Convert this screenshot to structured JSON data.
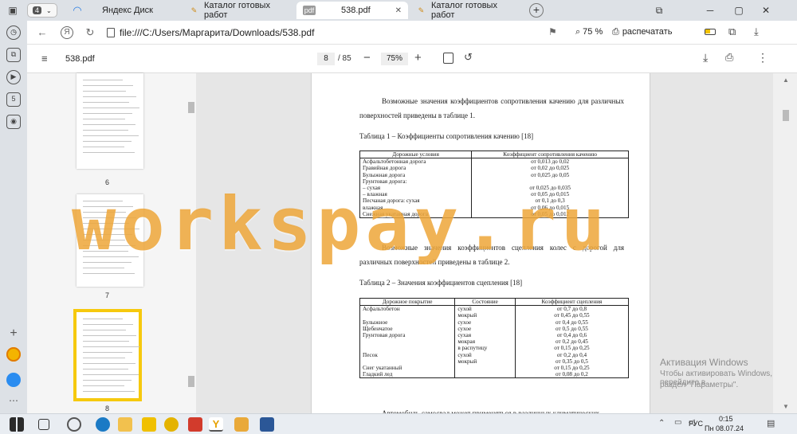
{
  "browser": {
    "tab_count": "4",
    "tabs": [
      {
        "label": "Яндекс Диск",
        "icon": "yandex-disk-icon"
      },
      {
        "label": "Каталог готовых работ",
        "icon": "catalog-icon"
      },
      {
        "label": "538.pdf",
        "icon": "pdf-icon"
      },
      {
        "label": "Каталог готовых работ",
        "icon": "catalog-icon"
      }
    ],
    "address": "file:///C:/Users/Маргарита/Downloads/538.pdf",
    "zoom": "75 %",
    "print_label": "распечатать"
  },
  "pdf_toolbar": {
    "filename": "538.pdf",
    "page_current": "8",
    "page_total": "/ 85",
    "zoom": "75%"
  },
  "thumbnails": {
    "labels": [
      "6",
      "7",
      "8"
    ]
  },
  "document": {
    "para1": "Возможные значения коэффициентов сопротивления качению для различных поверхностей приведены в таблице 1.",
    "table1_caption": "Таблица 1 – Коэффициенты сопротивления качению [18]",
    "table1_headers": [
      "Дорожные условия",
      "Коэффициент сопротивления качению"
    ],
    "table1_rows": [
      [
        "Асфальтобетонная дорога",
        "от 0,013 до 0,02"
      ],
      [
        "Гравийная дорога",
        "от 0,02 до 0,025"
      ],
      [
        "Булыжная дорога",
        "от 0,025 до 0,05"
      ],
      [
        "Грунтовая дорога:",
        ""
      ],
      [
        "– сухая",
        "от 0,025 до 0,035"
      ],
      [
        "– влажная",
        "от 0,05 до 0,015"
      ],
      [
        "Песчаная дорога: сухая",
        "от 0,1 до 0,3"
      ],
      [
        " влажная",
        "от 0,06 до 0,015"
      ],
      [
        "Снежная укатанная дорога",
        "от 0,05 до 0,012"
      ]
    ],
    "para2": "Возможные значения коэффициентов сцепления колес с дорогой для различных поверхностей приведены в таблице 2.",
    "table2_caption": "Таблица 2 – Значения коэффициентов сцепления [18]",
    "table2_headers": [
      "Дорожное покрытие",
      "Состояние",
      "Коэффициент сцепления"
    ],
    "table2_rows": [
      [
        "Асфальтобетон",
        "сухой",
        "от 0,7 до 0,8"
      ],
      [
        "",
        "мокрый",
        "от 0,45 до 0,55"
      ],
      [
        "Булыжное",
        "сухое",
        "от 0,4 до 0,55"
      ],
      [
        "Щебенчатое",
        "сухое",
        "от 0,5 до 0,55"
      ],
      [
        "Грунтовая дорога",
        "сухая",
        "от 0,4 до 0,6"
      ],
      [
        "",
        "мокрая",
        "от 0,2 до 0,45"
      ],
      [
        "",
        "в распутицу",
        "от 0,15 до 0,25"
      ],
      [
        "Песок",
        "сухой",
        "от 0,2 до 0,4"
      ],
      [
        "",
        "мокрый",
        "от 0,35 до 0,5"
      ],
      [
        "Снег укатанный",
        "",
        "от 0,15 до 0,25"
      ],
      [
        "Гладкий лед",
        "",
        "от 0,08 до 0,2"
      ]
    ],
    "para3": "Автомобиль-самосвал может применяться в различных климатических"
  },
  "watermark": "workspay.ru",
  "activation": {
    "line1": "Активация Windows",
    "line2": "Чтобы активировать Windows, перейдите в",
    "line3": "раздел \"Параметры\"."
  },
  "taskbar": {
    "lang": "РУС",
    "time": "0:15",
    "date": "Пн 08.07.24"
  }
}
